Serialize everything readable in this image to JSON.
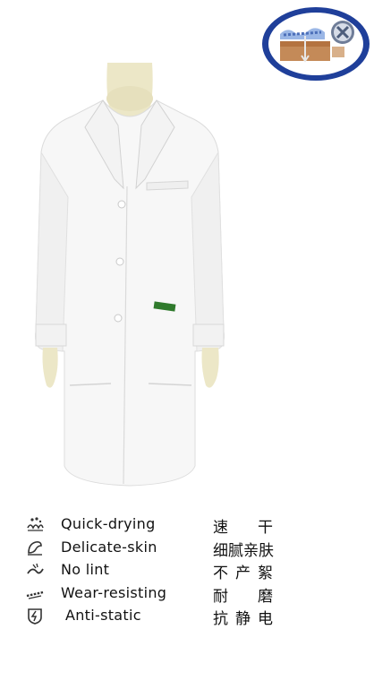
{
  "badge": {
    "icon": "fabric-technology-badge"
  },
  "product": {
    "image": "white-lab-coat-on-mannequin"
  },
  "features": [
    {
      "icon": "quick-drying-icon",
      "label": "Quick-drying",
      "cn": [
        "速",
        "干"
      ]
    },
    {
      "icon": "delicate-skin-icon",
      "label": "Delicate-skin",
      "cn": [
        "细",
        "腻",
        "亲",
        "肤"
      ]
    },
    {
      "icon": "no-lint-icon",
      "label": "No lint",
      "cn": [
        "不",
        "产",
        "絮"
      ]
    },
    {
      "icon": "wear-resisting-icon",
      "label": "Wear-resisting",
      "cn": [
        "耐",
        "磨"
      ]
    },
    {
      "icon": "anti-static-icon",
      "label": "Anti-static",
      "cn": [
        "抗",
        "静",
        "电"
      ]
    }
  ]
}
